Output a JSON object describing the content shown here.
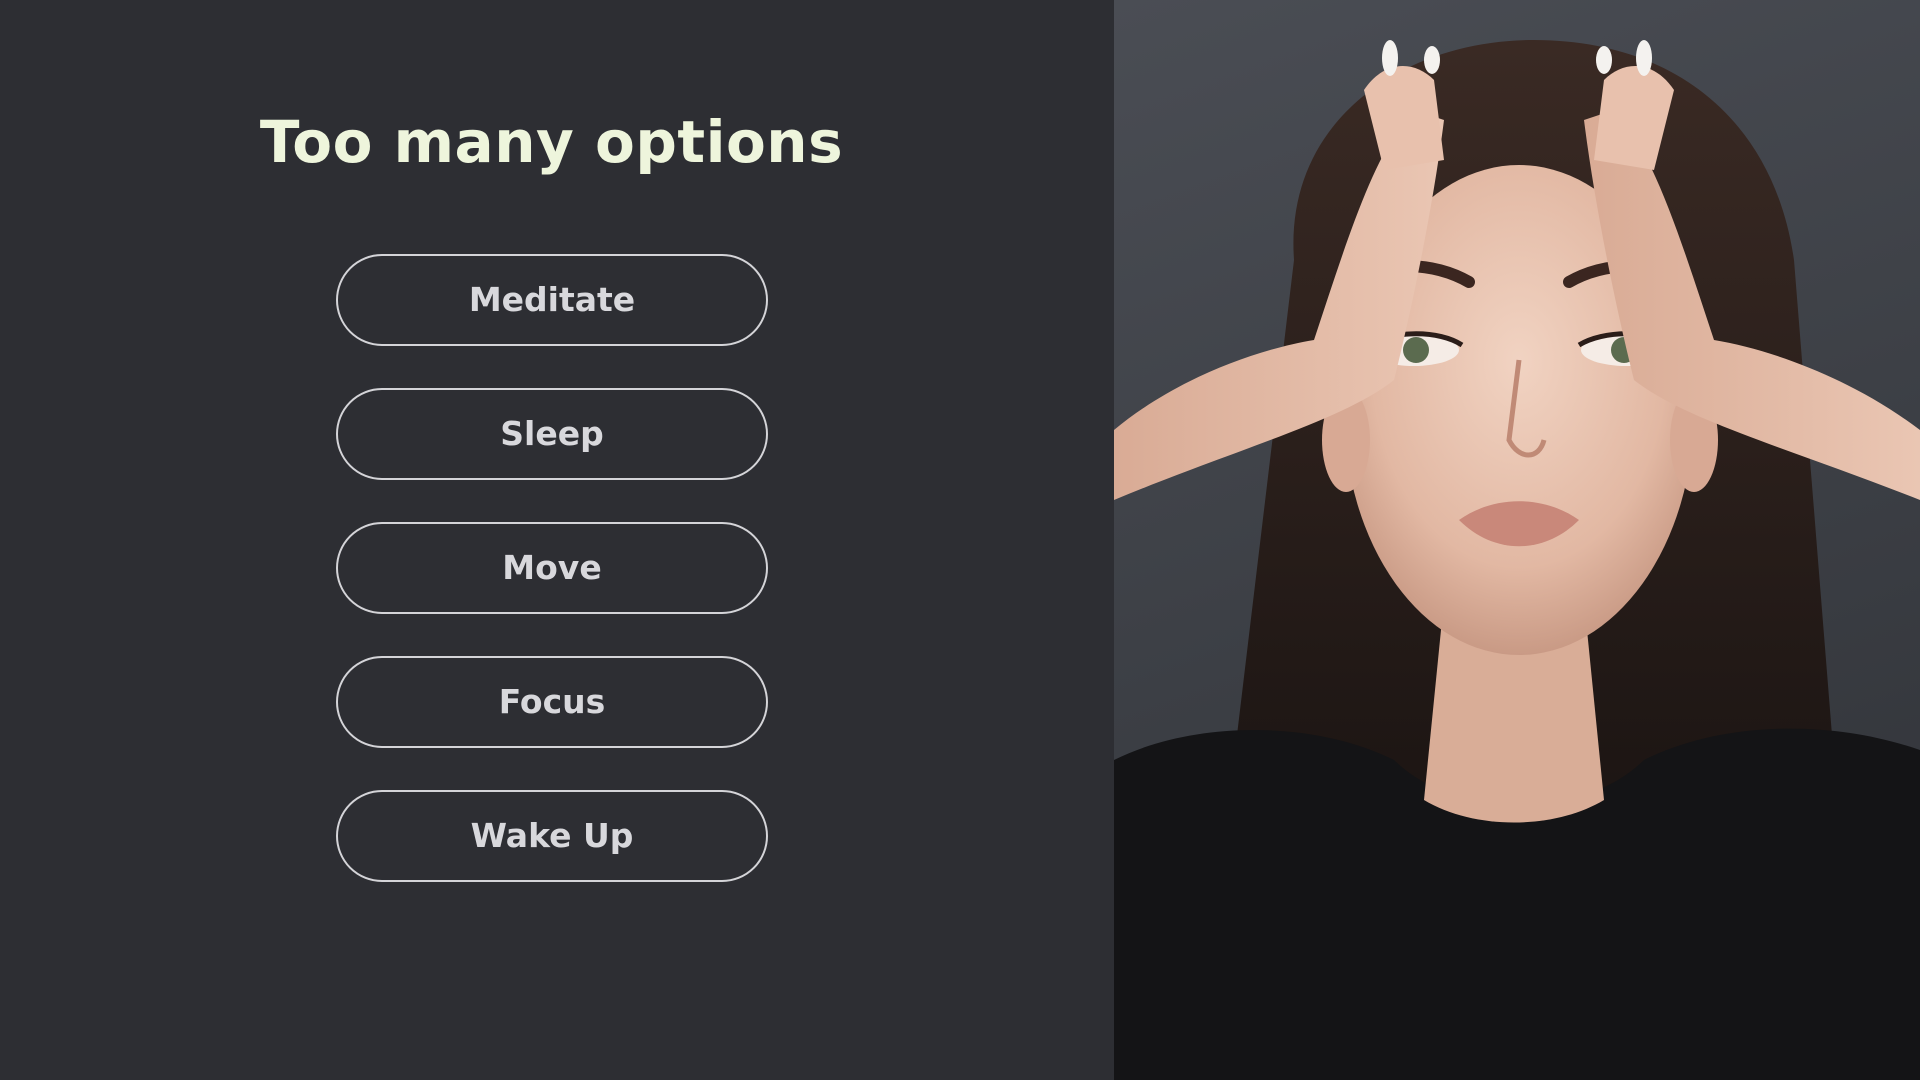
{
  "slide": {
    "title": "Too many options",
    "options": [
      {
        "label": "Meditate"
      },
      {
        "label": "Sleep"
      },
      {
        "label": "Move"
      },
      {
        "label": "Focus"
      },
      {
        "label": "Wake Up"
      }
    ]
  },
  "colors": {
    "background": "#2d2e33",
    "title": "#eef5dc",
    "button_border": "#d4d4d8",
    "button_text": "#d8d8dc"
  },
  "photo": {
    "icon": "woman-holding-head-photo"
  }
}
